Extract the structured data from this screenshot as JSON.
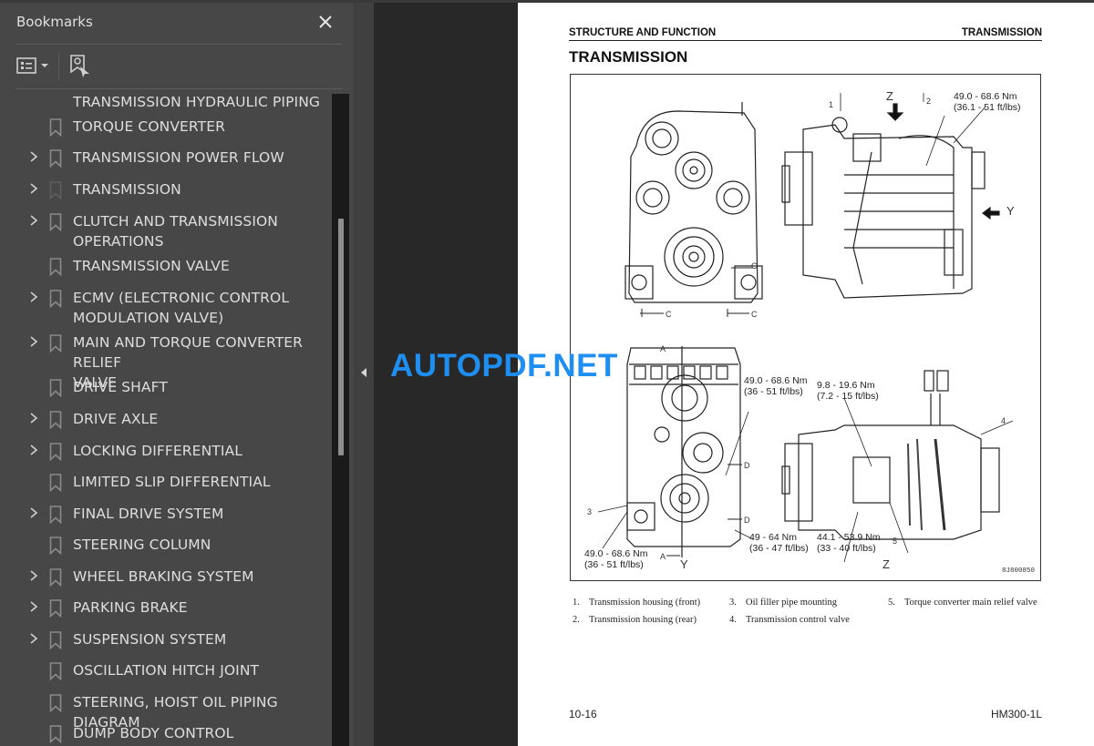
{
  "bookmarks_panel": {
    "title": "Bookmarks",
    "close_icon": "close-icon",
    "options_icon": "list-options-icon",
    "find_bookmark_icon": "find-current-bookmark-icon",
    "items": [
      {
        "label": "TRANSMISSION HYDRAULIC PIPING",
        "expandable": false,
        "partial": true
      },
      {
        "label": "TORQUE CONVERTER",
        "expandable": false
      },
      {
        "label": "TRANSMISSION POWER FLOW",
        "expandable": true
      },
      {
        "label": "TRANSMISSION",
        "expandable": true,
        "current": true
      },
      {
        "label": "CLUTCH AND TRANSMISSION OPERATIONS",
        "line1": "CLUTCH AND TRANSMISSION",
        "line2": "OPERATIONS",
        "expandable": true
      },
      {
        "label": "TRANSMISSION VALVE",
        "expandable": false
      },
      {
        "label": "ECMV (ELECTRONIC CONTROL MODULATION VALVE)",
        "line1": "ECMV (ELECTRONIC CONTROL",
        "line2": "MODULATION VALVE)",
        "expandable": true
      },
      {
        "label": "MAIN AND TORQUE CONVERTER RELIEF VALVE",
        "line1": "MAIN AND TORQUE CONVERTER RELIEF",
        "line2": "VALVE",
        "expandable": true
      },
      {
        "label": "DRIVE SHAFT",
        "expandable": false
      },
      {
        "label": "DRIVE AXLE",
        "expandable": true
      },
      {
        "label": "LOCKING DIFFERENTIAL",
        "expandable": true
      },
      {
        "label": "LIMITED SLIP DIFFERENTIAL",
        "expandable": false
      },
      {
        "label": "FINAL DRIVE SYSTEM",
        "expandable": true
      },
      {
        "label": "STEERING COLUMN",
        "expandable": false
      },
      {
        "label": "WHEEL BRAKING SYSTEM",
        "expandable": true
      },
      {
        "label": "PARKING BRAKE",
        "expandable": true
      },
      {
        "label": "SUSPENSION SYSTEM",
        "expandable": true
      },
      {
        "label": "OSCILLATION HITCH JOINT",
        "expandable": false
      },
      {
        "label": "STEERING, HOIST OIL PIPING DIAGRAM",
        "expandable": false
      },
      {
        "label": "DUMP BODY CONTROL",
        "expandable": false
      }
    ]
  },
  "collapse_icon": "collapse-panel-arrow-icon",
  "document": {
    "running_header_left": "STRUCTURE AND FUNCTION",
    "running_header_right": "TRANSMISSION",
    "title": "TRANSMISSION",
    "figure": {
      "torque_specs": [
        {
          "id": "t1",
          "line1": "49.0 - 68.6 Nm",
          "line2": "(36.1 - 51 ft/lbs)"
        },
        {
          "id": "t2",
          "line1": "49.0 - 68.6 Nm",
          "line2": "(36 - 51 ft/lbs)"
        },
        {
          "id": "t3",
          "line1": "9.8 - 19.6 Nm",
          "line2": "(7.2 - 15 ft/lbs)"
        },
        {
          "id": "t4",
          "line1": "49 - 64 Nm",
          "line2": "(36 - 47 ft/lbs)"
        },
        {
          "id": "t5",
          "line1": "44.1 - 53.9 Nm",
          "line2": "(33 - 40 ft/lbs)"
        },
        {
          "id": "t6",
          "line1": "49.0 - 68.6 Nm",
          "line2": "(36 - 51 ft/lbs)"
        }
      ],
      "view_letters": {
        "z_top": "Z",
        "y_side": "Y",
        "y_bottom": "Y",
        "z_bottom": "Z"
      },
      "section_marks": {
        "c": "C",
        "a": "A",
        "d": "D"
      },
      "part_numbers": [
        "1",
        "2",
        "3",
        "4",
        "5"
      ],
      "figure_code": "8J800850"
    },
    "legend": [
      {
        "num": "1.",
        "text": "Transmission housing (front)"
      },
      {
        "num": "2.",
        "text": "Transmission housing (rear)"
      },
      {
        "num": "3.",
        "text": "Oil filler pipe mounting"
      },
      {
        "num": "4.",
        "text": "Transmission control valve"
      },
      {
        "num": "5.",
        "text": "Torque converter main relief valve"
      }
    ],
    "footer_left": "10-16",
    "footer_right": "HM300-1L"
  },
  "watermark": "AUTOPDF.NET",
  "colors": {
    "panel_bg": "#474747",
    "canvas_bg": "#282828",
    "watermark": "#1f8ef1"
  }
}
